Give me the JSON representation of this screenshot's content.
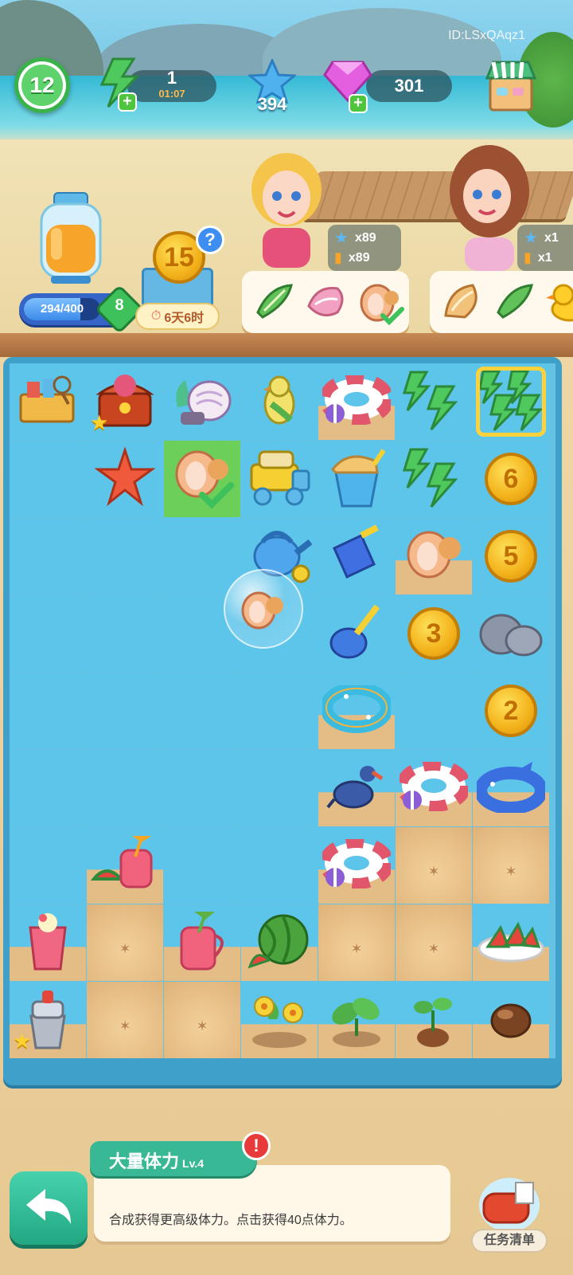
{
  "header": {
    "level": "12",
    "energy_value": "1",
    "energy_timer": "01:07",
    "star_count": "394",
    "gem_count": "301",
    "player_id": "ID:LSxQAqz1"
  },
  "jar": {
    "progress_text": "294/400",
    "progress_fraction": 0.735,
    "bonus": "8"
  },
  "event": {
    "coin_number": "15",
    "help": "?",
    "timer": "6天6时"
  },
  "customers": [
    {
      "reward_stars": "x89",
      "reward_drinks": "x89",
      "orders": [
        "green-shell-icon",
        "pink-shell-icon",
        "conch-shell-icon"
      ]
    },
    {
      "reward_stars": "x1",
      "reward_drinks": "x1",
      "orders": [
        "conch-shell-icon",
        "green-shell-icon",
        "rubber-duck-icon"
      ]
    }
  ],
  "board": {
    "rows": [
      [
        "toolbox",
        "treasure-chest",
        "coral-shell",
        "parrot",
        "swim-ring-pink",
        "energy-bolt",
        "energy-bolt-big"
      ],
      [
        "",
        "starfish",
        "conch-done",
        "toy-truck",
        "sand-bucket",
        "energy-bolt",
        "coin-6"
      ],
      [
        "",
        "",
        "",
        "watering-can",
        "sand-scoop",
        "conch-shell",
        "coin-5"
      ],
      [
        "",
        "",
        "",
        "",
        "sand-shovel",
        "coin-3",
        "rocks"
      ],
      [
        "",
        "",
        "",
        "",
        "swim-ring-blue",
        "",
        "coin-2"
      ],
      [
        "",
        "",
        "",
        "",
        "seagull",
        "swim-ring-pink",
        "shark-float"
      ],
      [
        "",
        "watermelon-juice",
        "",
        "",
        "swim-ring-pink",
        "sand",
        "sand"
      ],
      [
        "smoothie",
        "sand",
        "juice-pitcher",
        "watermelon",
        "sand",
        "sand",
        "watermelon-plate"
      ],
      [
        "juicer",
        "sand",
        "sand",
        "flower-pot",
        "plant-pot",
        "sprout",
        "seed"
      ]
    ],
    "coin_labels": {
      "coin-6": "6",
      "coin-5": "5",
      "coin-3": "3",
      "coin-2": "2"
    }
  },
  "info": {
    "title": "大量体力",
    "level": "Lv.4",
    "description": "合成获得更高级体力。点击获得40点体力。",
    "alert": "!"
  },
  "task_list_label": "任务清单",
  "colors": {
    "accent_green": "#38b894",
    "board_blue": "#5dc4ea",
    "coin_gold": "#f3b21b",
    "energy_green": "#52c46a"
  }
}
